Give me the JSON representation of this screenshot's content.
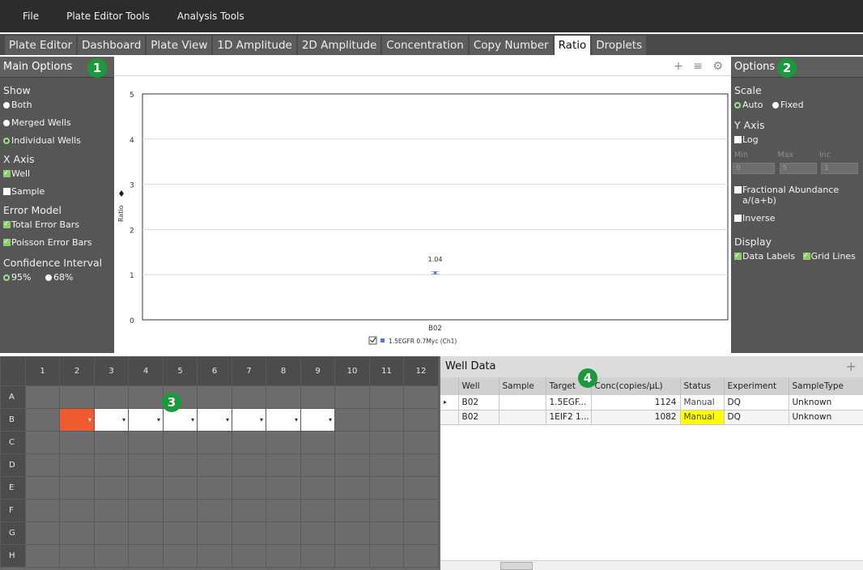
{
  "menu": [
    "File",
    "Plate Editor Tools",
    "Analysis Tools"
  ],
  "tabs": [
    "Plate Editor",
    "Dashboard",
    "Plate View",
    "1D Amplitude",
    "2D Amplitude",
    "Concentration",
    "Copy Number",
    "Ratio",
    "Droplets"
  ],
  "active_tab": "Ratio",
  "main_options": {
    "title": "Main Options",
    "badge": "1",
    "show_label": "Show",
    "show": [
      "Both",
      "Merged Wells",
      "Individual Wells"
    ],
    "xaxis_label": "X Axis",
    "xaxis": [
      "Well",
      "Sample"
    ],
    "error_label": "Error Model",
    "error": [
      "Total Error Bars",
      "Poisson Error Bars"
    ],
    "ci_label": "Confidence Interval",
    "ci": [
      "95%",
      "68%"
    ]
  },
  "options": {
    "title": "Options",
    "badge": "2",
    "scale_label": "Scale",
    "scale": [
      "Auto",
      "Fixed"
    ],
    "yaxis_label": "Y Axis",
    "log": "Log",
    "min_label": "Min",
    "max_label": "Max",
    "inc_label": "Inc",
    "min_val": "0",
    "max_val": "5",
    "inc_val": "1",
    "fractional": "Fractional Abundance",
    "fractional_formula": "a/(a+b)",
    "inverse": "Inverse",
    "display_label": "Display",
    "data_labels": "Data Labels",
    "grid_lines": "Grid Lines"
  },
  "chart_toolbar": "+ ≡ ⚙",
  "chart_data": {
    "type": "scatter",
    "categories": [
      "B02"
    ],
    "values": [
      1.04
    ],
    "ylabel": "Ratio",
    "ylim": [
      0,
      5
    ],
    "yticks": [
      "0",
      "1",
      "2",
      "3",
      "4",
      "5"
    ],
    "grid": true,
    "data_labels": [
      "1.04"
    ],
    "legend": "1.5EGFR 0.7Myc (Ch1)",
    "legend_placement": "bottom",
    "legend_color": "#5577cc"
  },
  "plate": {
    "badge": "3",
    "cols": [
      "1",
      "2",
      "3",
      "4",
      "5",
      "6",
      "7",
      "8",
      "9",
      "10",
      "11",
      "12"
    ],
    "rows": [
      "A",
      "B",
      "C",
      "D",
      "E",
      "F",
      "G",
      "H"
    ],
    "highlight_color": "#ef5a2e"
  },
  "well_data": {
    "title": "Well Data",
    "badge": "4",
    "plus": "+",
    "columns": [
      "Well",
      "Sample",
      "Target",
      "Conc(copies/µL)",
      "Status",
      "Experiment",
      "SampleType"
    ],
    "rows": [
      [
        "B02",
        "",
        "1.5EGF...",
        "1124",
        "Manual",
        "DQ",
        "Unknown"
      ],
      [
        "B02",
        "",
        "1EIF2 1...",
        "1082",
        "Manual",
        "DQ",
        "Unknown"
      ]
    ],
    "status_color": "#ffff00"
  }
}
